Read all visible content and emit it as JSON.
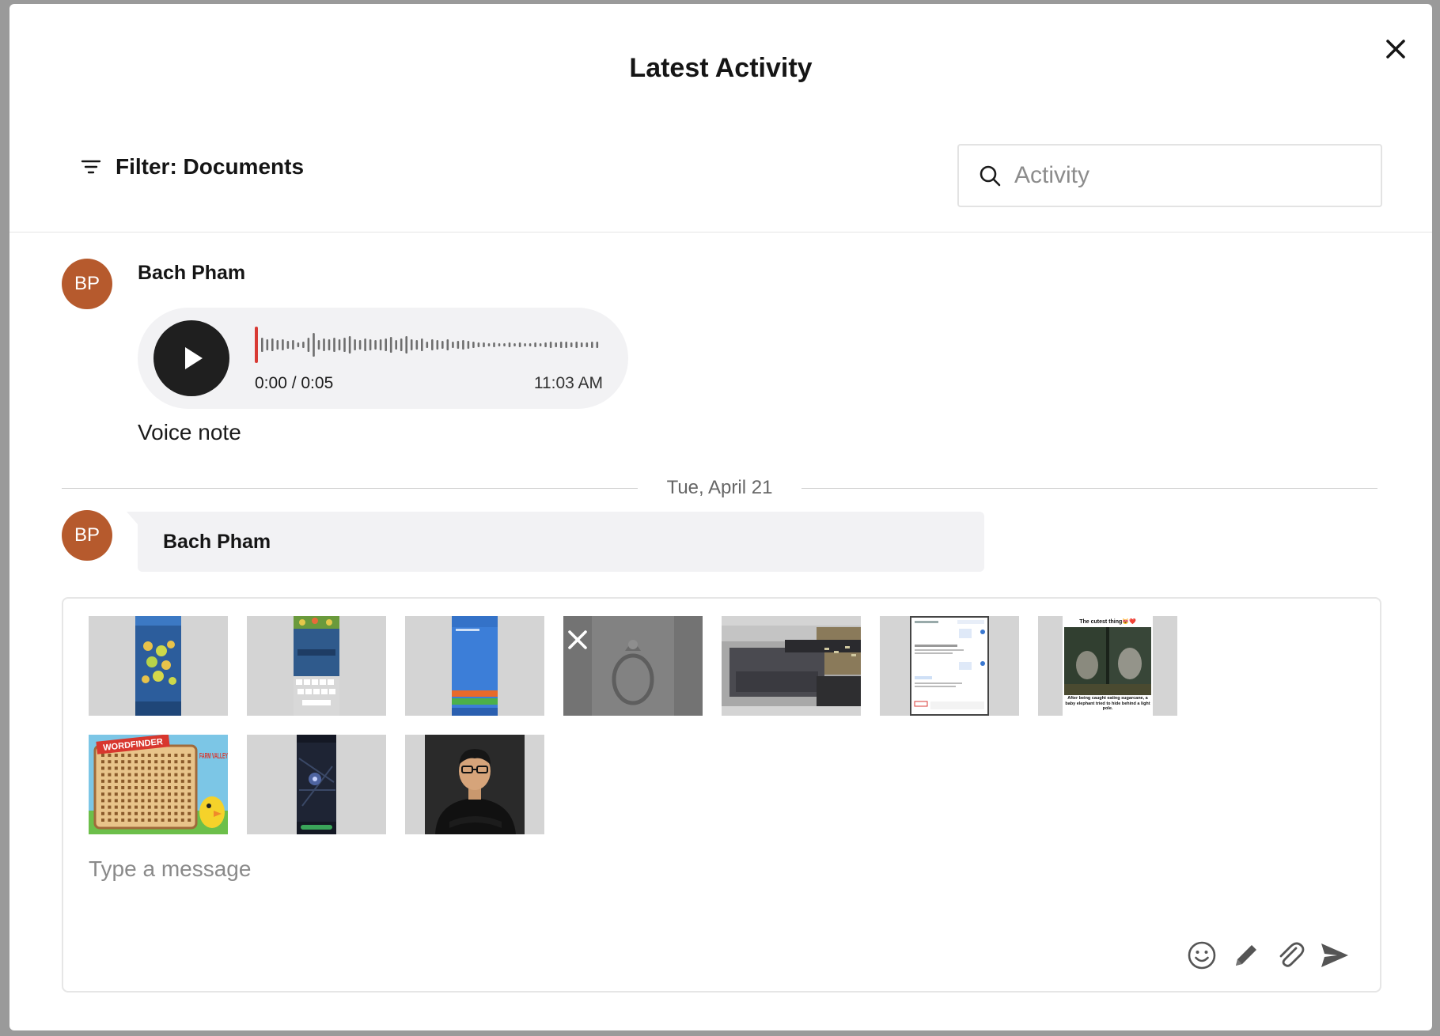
{
  "modal": {
    "title": "Latest Activity"
  },
  "filter": {
    "label": "Filter: Documents"
  },
  "search": {
    "placeholder": "Activity"
  },
  "messages": [
    {
      "initials": "BP",
      "sender": "Bach Pham",
      "voice": {
        "position": "0:00",
        "duration": "0:05",
        "elapsed_text": "0:00 / 0:05",
        "time": "11:03 AM",
        "progress": 0.0
      },
      "caption": "Voice note"
    },
    {
      "initials": "BP",
      "sender": "Bach Pham"
    }
  ],
  "date_separator": "Tue, April 21",
  "composer": {
    "placeholder": "Type a message",
    "attachments": [
      {
        "kind": "phone-game-screenshot"
      },
      {
        "kind": "phone-keyboard-screenshot"
      },
      {
        "kind": "phone-blue-screenshot"
      },
      {
        "kind": "ring-photo",
        "selected": true
      },
      {
        "kind": "printer-photo"
      },
      {
        "kind": "chat-screenshot"
      },
      {
        "kind": "elephant-meme",
        "caption_top": "The cutest thing😻❤️",
        "caption_bottom": "After being caught eating sugarcane, a baby elephant tried to hide behind a light pole."
      },
      {
        "kind": "wordfinder-game",
        "brand": "WORDFINDER",
        "brand2": "FARM VALLEY"
      },
      {
        "kind": "phone-dark-map-screenshot"
      },
      {
        "kind": "portrait-photo"
      }
    ]
  },
  "colors": {
    "avatar": "#b65a2d",
    "bubble": "#f2f2f4",
    "accent_progress": "#d83a34"
  },
  "icons": {
    "close": "close-icon",
    "filter": "filter-icon",
    "search": "search-icon",
    "play": "play-icon",
    "emoji": "emoji-icon",
    "pencil": "pencil-icon",
    "attach": "paperclip-icon",
    "send": "send-icon",
    "remove": "remove-attachment-icon"
  }
}
